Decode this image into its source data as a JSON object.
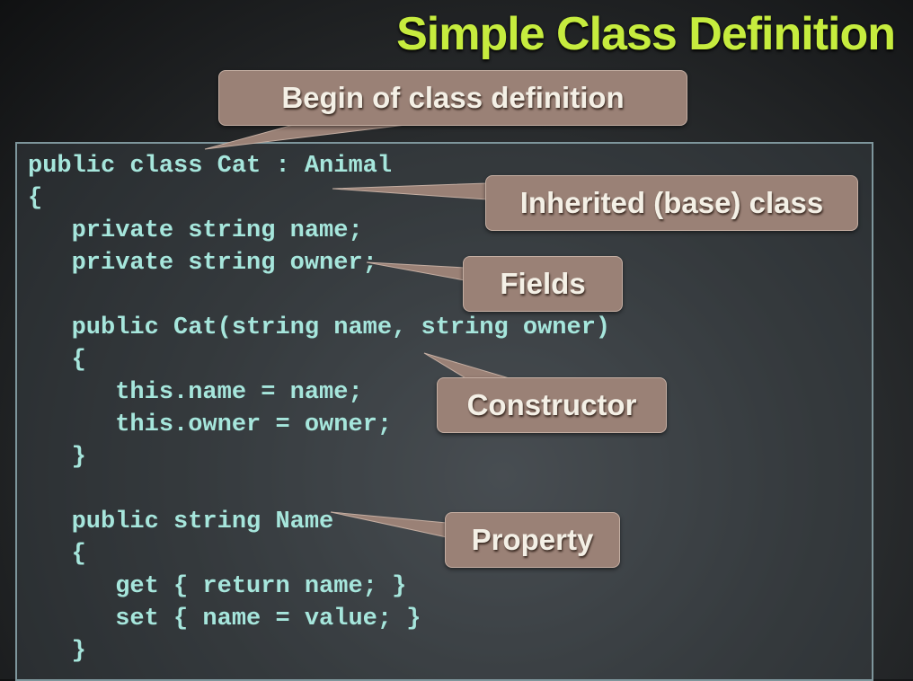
{
  "title": "Simple Class Definition",
  "code_lines": [
    "public class Cat : Animal",
    "{",
    "   private string name;",
    "   private string owner;",
    "",
    "   public Cat(string name, string owner)",
    "   {",
    "      this.name = name;",
    "      this.owner = owner;",
    "   }",
    "",
    "   public string Name",
    "   {",
    "      get { return name; }",
    "      set { name = value; }",
    "   }"
  ],
  "callouts": {
    "begin": "Begin of class definition",
    "inherited": "Inherited (base) class",
    "fields": "Fields",
    "constructor": "Constructor",
    "property": "Property"
  },
  "colors": {
    "title": "#c6ec3e",
    "code": "#a6e6dc",
    "callout": "#9a8176"
  }
}
